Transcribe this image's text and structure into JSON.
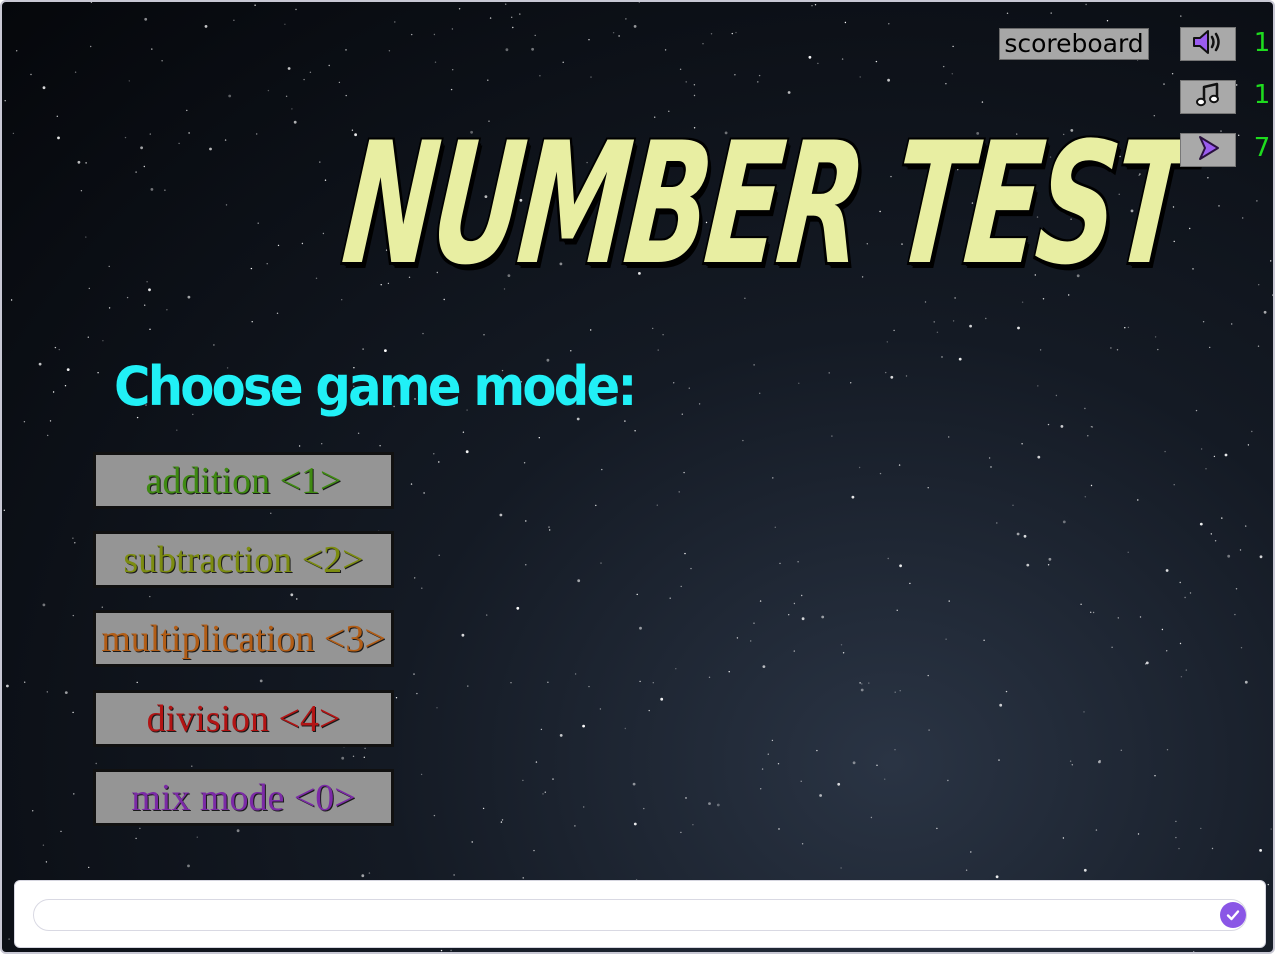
{
  "title": "NUMBER TEST",
  "subtitle": "Choose game mode:",
  "modes": [
    {
      "label": "addition <1>",
      "color": "#3f8a12"
    },
    {
      "label": "subtraction <2>",
      "color": "#7c8c10"
    },
    {
      "label": "multiplication <3>",
      "color": "#b25d16"
    },
    {
      "label": "division <4>",
      "color": "#b21414"
    },
    {
      "label": "mix mode <0>",
      "color": "#7b2aa6"
    }
  ],
  "controls": {
    "scoreboard_label": "scoreboard",
    "sound": {
      "icon": "speaker-icon",
      "value": "1"
    },
    "music": {
      "icon": "music-note-icon",
      "value": "1"
    },
    "speed": {
      "icon": "play-arrow-icon",
      "value": "7"
    }
  },
  "input": {
    "placeholder": "",
    "submit_icon": "check-circle-icon"
  },
  "colors": {
    "title": "#e8eea2",
    "subtitle": "#21f0f6",
    "button_bg": "#959595",
    "control_value": "#1edc1e",
    "accent": "#8a56e6"
  }
}
